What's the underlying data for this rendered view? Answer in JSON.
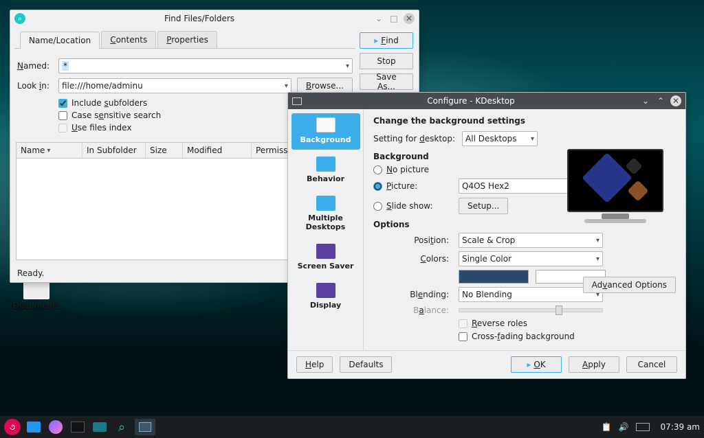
{
  "desktop_icons": {
    "documents": "Documents"
  },
  "find_window": {
    "title": "Find Files/Folders",
    "tabs": {
      "nameloc": "Name/Location",
      "contents": "Contents",
      "properties": "Properties"
    },
    "labels": {
      "named": "Named:",
      "lookin": "Look in:"
    },
    "named_value": "*",
    "lookin_value": "file:///home/adminu",
    "browse": "Browse...",
    "checks": {
      "subfolders": "Include subfolders",
      "casesens": "Case sensitive search",
      "filesindex": "Use files index"
    },
    "columns": {
      "name": "Name",
      "subfolder": "In Subfolder",
      "size": "Size",
      "modified": "Modified",
      "permissions": "Permission"
    },
    "buttons": {
      "find": "Find",
      "stop": "Stop",
      "saveas": "Save As..."
    },
    "status": "Ready."
  },
  "config_window": {
    "title": "Configure - KDesktop",
    "side": {
      "background": "Background",
      "behavior": "Behavior",
      "multiple": "Multiple Desktops",
      "saver": "Screen Saver",
      "display": "Display"
    },
    "heading": "Change the background settings",
    "setting_for": "Setting for desktop:",
    "setting_value": "All Desktops",
    "bg_section": "Background",
    "bg": {
      "nopic": "No picture",
      "picture": "Picture:",
      "picture_value": "Q4OS Hex2",
      "slide": "Slide show:",
      "setup": "Setup..."
    },
    "options_section": "Options",
    "options": {
      "position": "Position:",
      "position_value": "Scale & Crop",
      "colors": "Colors:",
      "colors_value": "Single Color",
      "blending": "Blending:",
      "blending_value": "No Blending",
      "balance": "Balance:",
      "reverse": "Reverse roles",
      "crossfade": "Cross-fading background"
    },
    "adv": "Advanced Options",
    "buttons": {
      "help": "Help",
      "defaults": "Defaults",
      "ok": "OK",
      "apply": "Apply",
      "cancel": "Cancel"
    }
  },
  "taskbar": {
    "clock": "07:39 am"
  }
}
